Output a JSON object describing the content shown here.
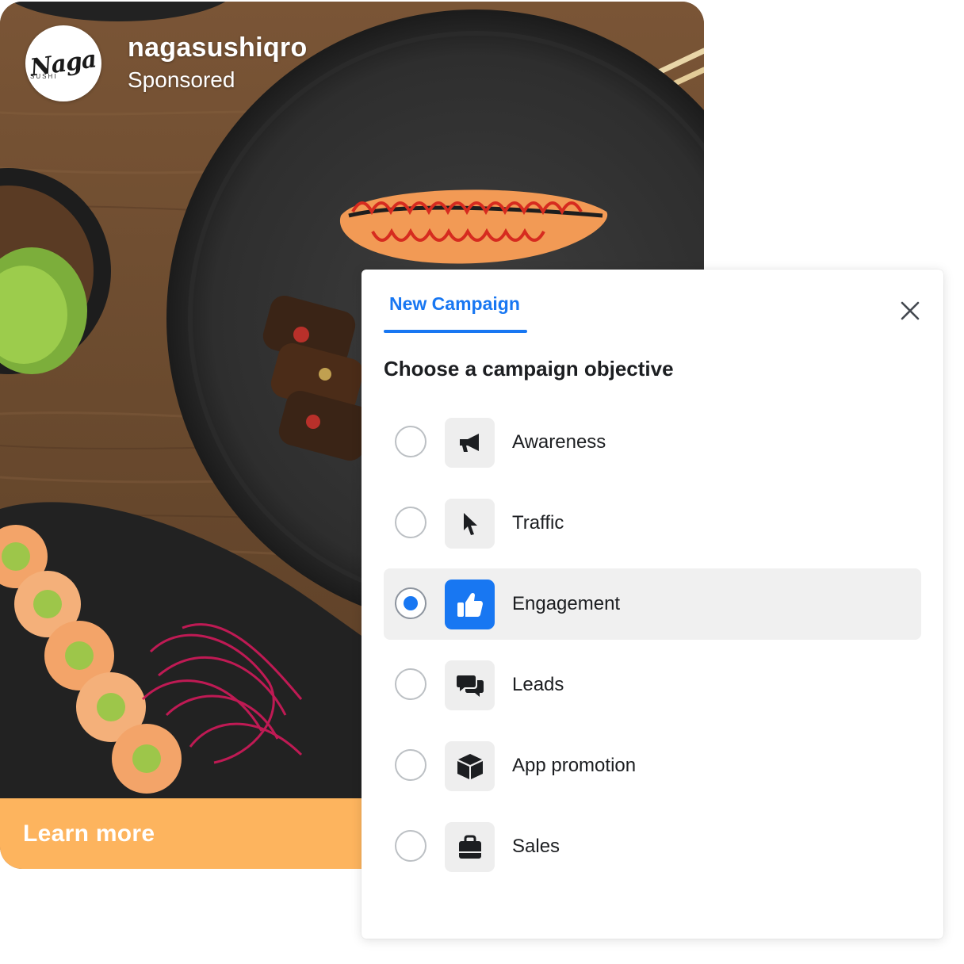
{
  "post": {
    "account_name": "nagasushiqro",
    "sponsored_label": "Sponsored",
    "avatar_logo_word": "Naga",
    "avatar_logo_sub": "SUSHI",
    "cta_label": "Learn more",
    "cta_color": "#fdb45e"
  },
  "dialog": {
    "tab_label": "New Campaign",
    "heading": "Choose a campaign objective",
    "close_icon": "close-icon",
    "accent_color": "#1877f2",
    "objectives": [
      {
        "label": "Awareness",
        "icon": "megaphone-icon",
        "selected": false
      },
      {
        "label": "Traffic",
        "icon": "cursor-icon",
        "selected": false
      },
      {
        "label": "Engagement",
        "icon": "thumbs-up-icon",
        "selected": true
      },
      {
        "label": "Leads",
        "icon": "chat-bubbles-icon",
        "selected": false
      },
      {
        "label": "App promotion",
        "icon": "box-icon",
        "selected": false
      },
      {
        "label": "Sales",
        "icon": "shopping-bag-icon",
        "selected": false
      }
    ]
  }
}
